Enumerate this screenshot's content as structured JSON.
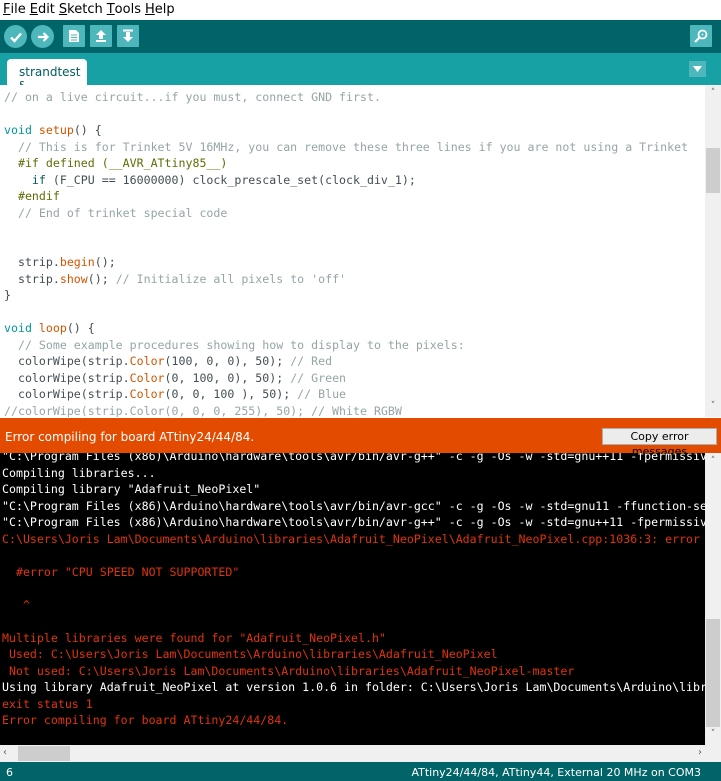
{
  "menu": {
    "items": [
      {
        "ul": "F",
        "rest": "ile"
      },
      {
        "ul": "E",
        "rest": "dit"
      },
      {
        "ul": "S",
        "rest": "ketch"
      },
      {
        "ul": "T",
        "rest": "ools"
      },
      {
        "ul": "H",
        "rest": "elp"
      }
    ]
  },
  "toolbar": {
    "buttons": [
      "verify-icon",
      "upload-icon",
      "new-icon",
      "open-icon",
      "save-icon"
    ],
    "serial_monitor": "serial-monitor-icon",
    "accent": "#006468",
    "button_color": "#4db7bb"
  },
  "tabs": [
    {
      "label": "strandtest §"
    }
  ],
  "editor": {
    "lines": [
      [
        {
          "t": "// on a live circuit...if you must, connect GND first.",
          "c": "c"
        }
      ],
      [
        {
          "t": "",
          "c": ""
        }
      ],
      [
        {
          "t": "void",
          "c": "k"
        },
        {
          "t": " ",
          "c": ""
        },
        {
          "t": "setup",
          "c": "f"
        },
        {
          "t": "() {",
          "c": ""
        }
      ],
      [
        {
          "t": "  // This is for Trinket 5V 16MHz, you can remove these three lines if you are not using a Trinket",
          "c": "c"
        }
      ],
      [
        {
          "t": "  #if defined (__AVR_ATtiny85__)",
          "c": "p"
        }
      ],
      [
        {
          "t": "    ",
          "c": ""
        },
        {
          "t": "if",
          "c": "s"
        },
        {
          "t": " (F_CPU == 16000000) clock_prescale_set(clock_div_1);",
          "c": ""
        }
      ],
      [
        {
          "t": "  #endif",
          "c": "p"
        }
      ],
      [
        {
          "t": "  // End of trinket special code",
          "c": "c"
        }
      ],
      [
        {
          "t": "",
          "c": ""
        }
      ],
      [
        {
          "t": "",
          "c": ""
        }
      ],
      [
        {
          "t": "  strip.",
          "c": ""
        },
        {
          "t": "begin",
          "c": "f"
        },
        {
          "t": "();",
          "c": ""
        }
      ],
      [
        {
          "t": "  strip.",
          "c": ""
        },
        {
          "t": "show",
          "c": "f"
        },
        {
          "t": "(); ",
          "c": ""
        },
        {
          "t": "// Initialize all pixels to 'off'",
          "c": "c"
        }
      ],
      [
        {
          "t": "}",
          "c": ""
        }
      ],
      [
        {
          "t": "",
          "c": ""
        }
      ],
      [
        {
          "t": "void",
          "c": "k"
        },
        {
          "t": " ",
          "c": ""
        },
        {
          "t": "loop",
          "c": "f"
        },
        {
          "t": "() {",
          "c": ""
        }
      ],
      [
        {
          "t": "  // Some example procedures showing how to display to the pixels:",
          "c": "c"
        }
      ],
      [
        {
          "t": "  colorWipe(strip.",
          "c": ""
        },
        {
          "t": "Color",
          "c": "f"
        },
        {
          "t": "(100, 0, 0), 50); ",
          "c": ""
        },
        {
          "t": "// Red",
          "c": "c"
        }
      ],
      [
        {
          "t": "  colorWipe(strip.",
          "c": ""
        },
        {
          "t": "Color",
          "c": "f"
        },
        {
          "t": "(0, 100, 0), 50); ",
          "c": ""
        },
        {
          "t": "// Green",
          "c": "c"
        }
      ],
      [
        {
          "t": "  colorWipe(strip.",
          "c": ""
        },
        {
          "t": "Color",
          "c": "f"
        },
        {
          "t": "(0, 0, 100 ), 50); ",
          "c": ""
        },
        {
          "t": "// Blue",
          "c": "c"
        }
      ],
      [
        {
          "t": "//colorWipe(strip.Color(0, 0, 0, 255), 50); // White RGBW",
          "c": "c"
        }
      ]
    ]
  },
  "status": {
    "message": "Error compiling for board ATtiny24/44/84.",
    "copy_button": "Copy error messages",
    "color": "#e34c00"
  },
  "console": {
    "lines": [
      {
        "t": "\"C:\\Program Files (x86)\\Arduino\\hardware\\tools\\avr/bin/avr-g++\" -c -g -Os -w -std=gnu++11 -fpermissive",
        "c": "cw"
      },
      {
        "t": "Compiling libraries...",
        "c": "cw"
      },
      {
        "t": "Compiling library \"Adafruit_NeoPixel\"",
        "c": "cw"
      },
      {
        "t": "\"C:\\Program Files (x86)\\Arduino\\hardware\\tools\\avr/bin/avr-gcc\" -c -g -Os -w -std=gnu11 -ffunction-se",
        "c": "cw"
      },
      {
        "t": "\"C:\\Program Files (x86)\\Arduino\\hardware\\tools\\avr/bin/avr-g++\" -c -g -Os -w -std=gnu++11 -fpermissiv",
        "c": "cw"
      },
      {
        "t": "C:\\Users\\Joris Lam\\Documents\\Arduino\\libraries\\Adafruit_NeoPixel\\Adafruit_NeoPixel.cpp:1036:3: error",
        "c": "ce"
      },
      {
        "t": "",
        "c": "ce"
      },
      {
        "t": "  #error \"CPU SPEED NOT SUPPORTED\"",
        "c": "ce"
      },
      {
        "t": "",
        "c": "ce"
      },
      {
        "t": "   ^",
        "c": "ce"
      },
      {
        "t": "",
        "c": "ce"
      },
      {
        "t": "Multiple libraries were found for \"Adafruit_NeoPixel.h\"",
        "c": "ce"
      },
      {
        "t": " Used: C:\\Users\\Joris Lam\\Documents\\Arduino\\libraries\\Adafruit_NeoPixel",
        "c": "ce"
      },
      {
        "t": " Not used: C:\\Users\\Joris Lam\\Documents\\Arduino\\libraries\\Adafruit_NeoPixel-master",
        "c": "ce"
      },
      {
        "t": "Using library Adafruit_NeoPixel at version 1.0.6 in folder: C:\\Users\\Joris Lam\\Documents\\Arduino\\libr",
        "c": "cw"
      },
      {
        "t": "exit status 1",
        "c": "ce"
      },
      {
        "t": "Error compiling for board ATtiny24/44/84.",
        "c": "ce"
      }
    ]
  },
  "footer": {
    "line_number": "6",
    "board_info": "ATtiny24/44/84, ATtiny44, External 20 MHz on COM3"
  }
}
